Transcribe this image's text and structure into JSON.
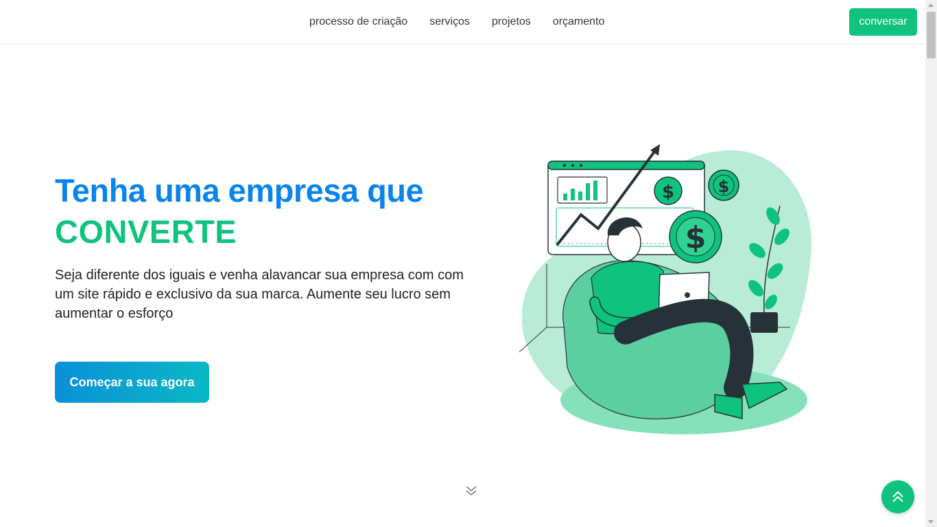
{
  "nav": {
    "links": [
      "processo de criação",
      "serviços",
      "projetos",
      "orçamento"
    ],
    "cta_label": "conversar"
  },
  "hero": {
    "title_line1": "Tenha uma empresa que",
    "title_line2": "CONVERTE",
    "description": "Seja diferente dos iguais e venha alavancar sua empresa com com um site rápido e exclusivo da sua marca. Aumente seu lucro sem aumentar o esforço",
    "button_label": "Começar a sua agora"
  },
  "icons": {
    "scroll_down": "double-chevron-down-icon",
    "back_to_top": "double-chevron-up-icon"
  },
  "colors": {
    "accent_green": "#0fc27d",
    "title_blue": "#0a84ea",
    "button_gradient_start": "#0a90d9",
    "button_gradient_end": "#09b8c4"
  }
}
